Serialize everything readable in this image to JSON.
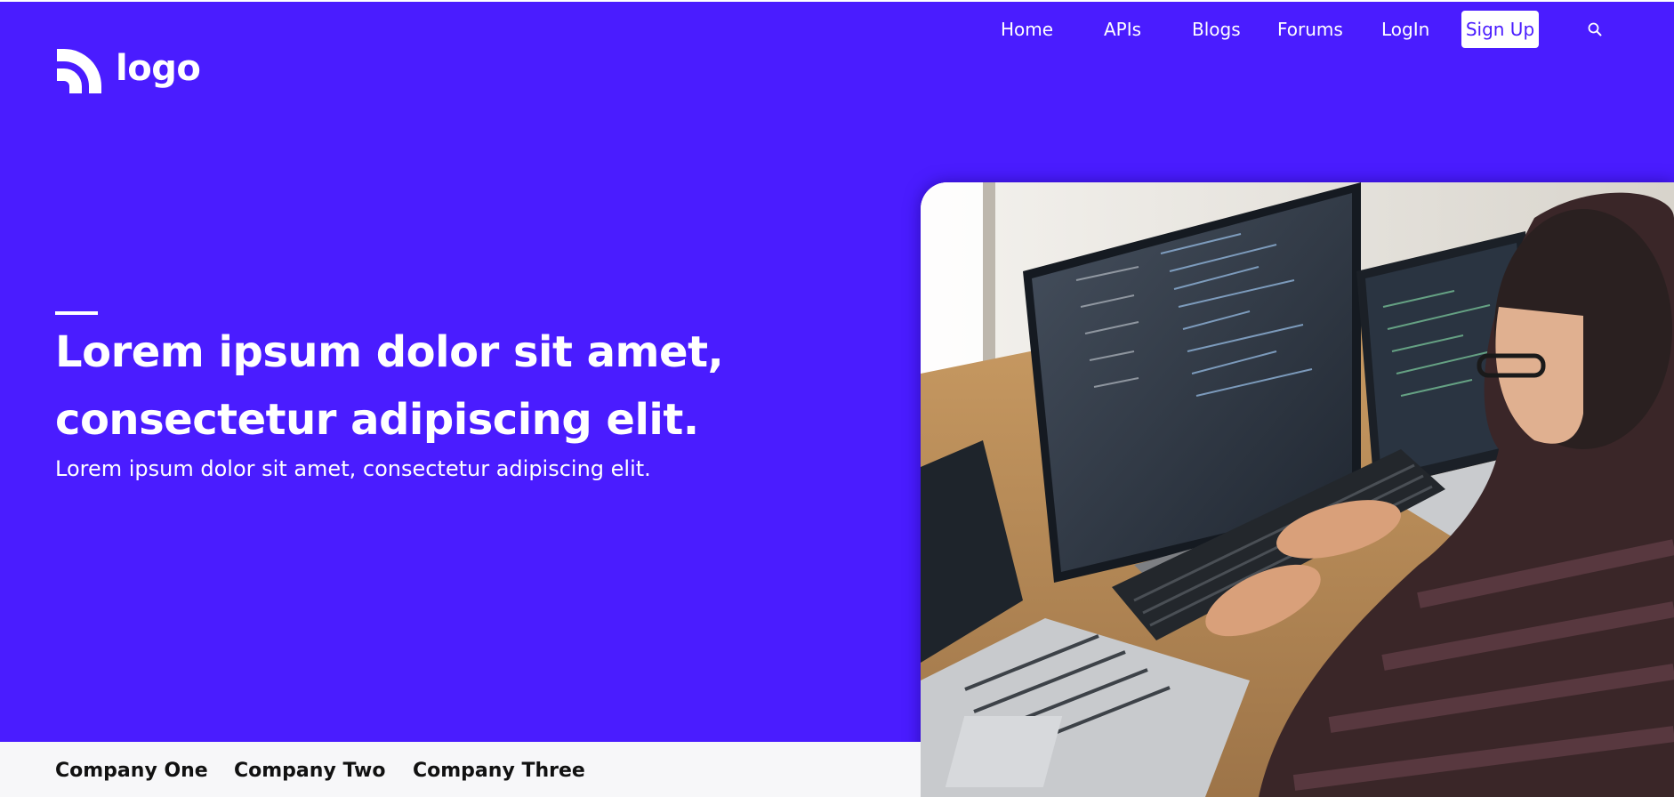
{
  "logo": {
    "text": "logo",
    "icon": "rss-logo-icon"
  },
  "nav": {
    "items": [
      {
        "label": "Home"
      },
      {
        "label": "APIs"
      },
      {
        "label": "Blogs"
      },
      {
        "label": "Forums"
      },
      {
        "label": "LogIn"
      }
    ],
    "signup_label": "Sign Up",
    "search_icon": "search-icon"
  },
  "hero": {
    "headline_line1": "Lorem ipsum dolor sit amet,",
    "headline_line2": "consectetur adipiscing elit.",
    "subheadline": "Lorem ipsum dolor sit amet, consectetur adipiscing elit.",
    "image_icon": "developer-at-computer-photo"
  },
  "companies": [
    {
      "name": "Company One"
    },
    {
      "name": "Company Two"
    },
    {
      "name": "Company Three"
    }
  ],
  "colors": {
    "brand": "#4a1cff",
    "strip": "#f7f7f9",
    "text_dark": "#111111",
    "text_light": "#ffffff"
  }
}
